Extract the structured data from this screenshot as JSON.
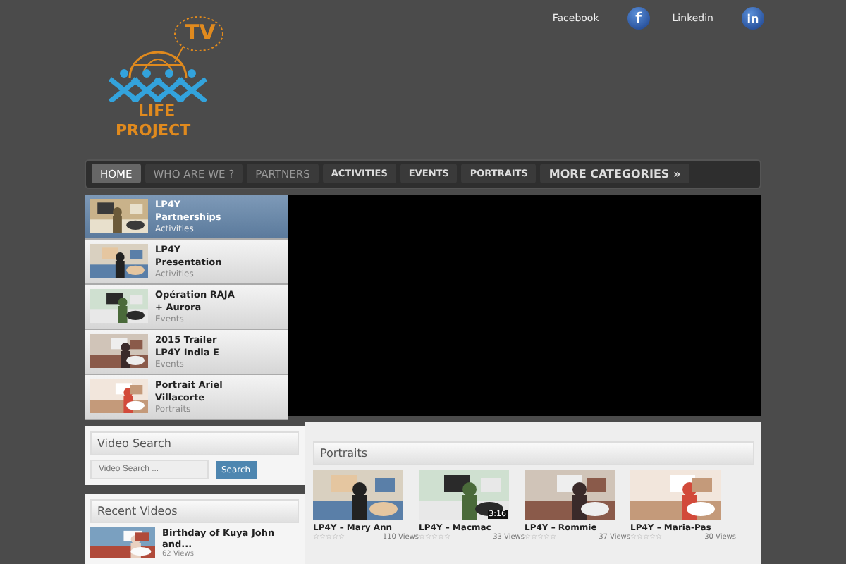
{
  "logo": {
    "badge": "TV",
    "line1": "LIFE",
    "line2": "PROJECT"
  },
  "social": [
    {
      "label": "Facebook",
      "icon": "f"
    },
    {
      "label": "Linkedin",
      "icon": "in"
    }
  ],
  "nav": [
    {
      "label": "HOME",
      "selected": true,
      "kind": "plain"
    },
    {
      "label": "WHO ARE WE ?",
      "selected": false,
      "kind": "plain"
    },
    {
      "label": "PARTNERS",
      "selected": false,
      "kind": "plain"
    },
    {
      "label": "ACTIVITIES",
      "selected": false,
      "kind": "bold"
    },
    {
      "label": "EVENTS",
      "selected": false,
      "kind": "bold"
    },
    {
      "label": "PORTRAITS",
      "selected": false,
      "kind": "bold"
    },
    {
      "label": "MORE CATEGORIES »",
      "selected": false,
      "kind": "big"
    }
  ],
  "playlist": [
    {
      "title": "LP4Y Partnerships",
      "category": "Activities",
      "selected": true
    },
    {
      "title": "LP4Y Presentation",
      "category": "Activities",
      "selected": false
    },
    {
      "title": "Opération RAJA + Aurora",
      "category": "Events",
      "selected": false
    },
    {
      "title": "2015 Trailer LP4Y India E",
      "category": "Events",
      "selected": false
    },
    {
      "title": "Portrait Ariel Villacorte",
      "category": "Portraits",
      "selected": false
    }
  ],
  "video_search": {
    "title": "Video Search",
    "placeholder": "Video Search ...",
    "button": "Search"
  },
  "recent": {
    "title": "Recent Videos",
    "items": [
      {
        "title": "Birthday of Kuya John and...",
        "views": "62 Views"
      }
    ]
  },
  "portraits": {
    "title": "Portraits",
    "items": [
      {
        "title": "LP4Y – Mary Ann",
        "views": "110 Views",
        "stars": 0
      },
      {
        "title": "LP4Y – Macmac",
        "views": "33 Views",
        "stars": 0,
        "duration": "3:16"
      },
      {
        "title": "LP4Y – Rommie",
        "views": "37 Views",
        "stars": 0
      },
      {
        "title": "LP4Y – Maria-Pas",
        "views": "30 Views",
        "stars": 0
      }
    ]
  }
}
